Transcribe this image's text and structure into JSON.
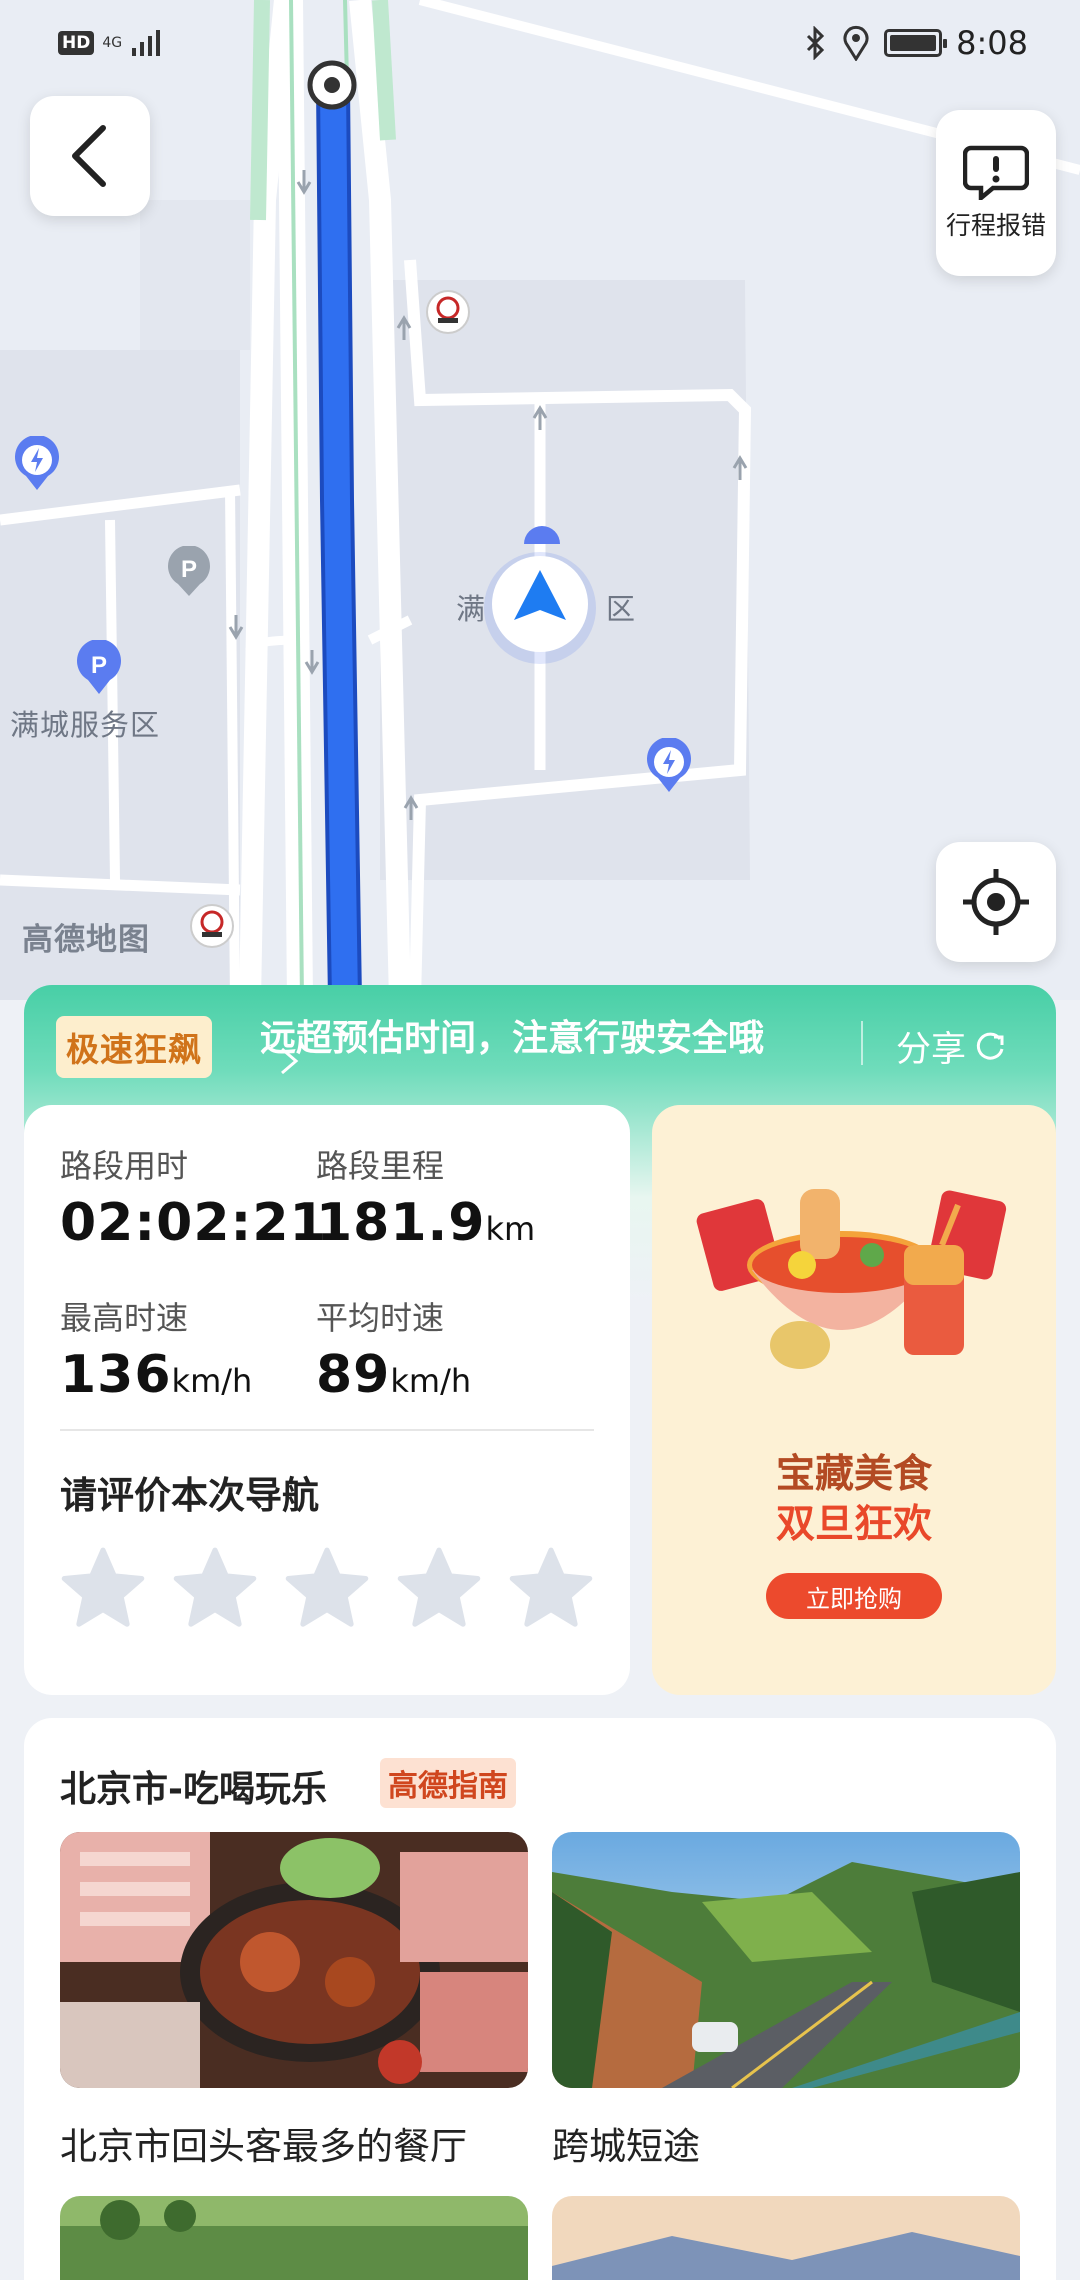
{
  "status_bar": {
    "hd": "HD",
    "network": "4G",
    "time": "8:08"
  },
  "map": {
    "labels": {
      "service_area_main": "满城服务区",
      "service_area_left_center": "满",
      "service_area_right_center": "区",
      "watermark": "高德地图"
    }
  },
  "map_buttons": {
    "report_label": "行程报错"
  },
  "summary": {
    "badge": "极速狂飙",
    "message": "远超预估时间，注意行驶安全哦",
    "share_label": "分享",
    "stats": {
      "duration_label": "路段用时",
      "duration_value": "02:02:21",
      "distance_label": "路段里程",
      "distance_value": "181.9",
      "distance_unit": "km",
      "max_speed_label": "最高时速",
      "max_speed_value": "136",
      "max_speed_unit": "km/h",
      "avg_speed_label": "平均时速",
      "avg_speed_value": "89",
      "avg_speed_unit": "km/h"
    },
    "rating": {
      "title": "请评价本次导航",
      "selected": 0,
      "max": 5
    },
    "promo": {
      "line1": "宝藏美食",
      "line2": "双旦狂欢",
      "button": "立即抢购"
    }
  },
  "guide": {
    "title": "北京市-吃喝玩乐",
    "tag": "高德指南",
    "items": [
      {
        "caption": "北京市回头客最多的餐厅"
      },
      {
        "caption": "跨城短途"
      }
    ]
  },
  "colors": {
    "route_blue": "#2f6ff0",
    "accent_green": "#48cfa6",
    "promo_red": "#ec4a2d"
  }
}
